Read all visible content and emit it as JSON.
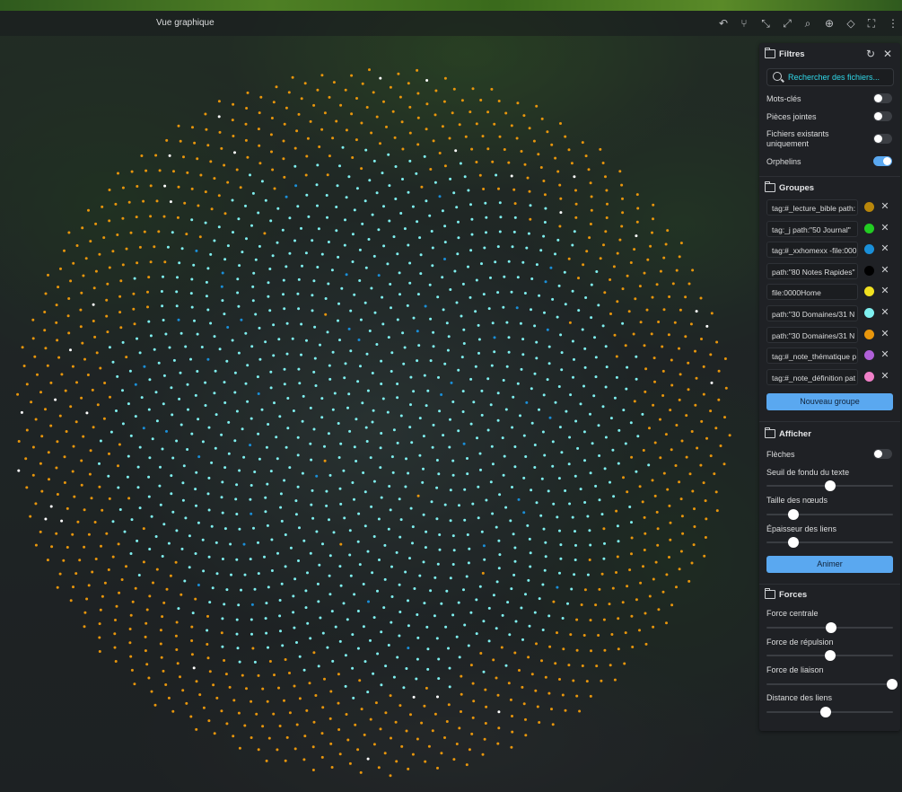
{
  "window": {
    "title": "Vue graphique"
  },
  "toolbar": {
    "icons": [
      "undo-icon",
      "branch-icon",
      "collapse-icon",
      "expand-icon",
      "search-icon",
      "compass-icon",
      "split-icon",
      "fullscreen-icon",
      "more-icon"
    ]
  },
  "filters": {
    "title": "Filtres",
    "search_placeholder": "Rechercher des fichiers...",
    "options": [
      {
        "label": "Mots-clés",
        "on": false
      },
      {
        "label": "Pièces jointes",
        "on": false
      },
      {
        "label": "Fichiers existants uniquement",
        "on": false
      },
      {
        "label": "Orphelins",
        "on": true
      }
    ]
  },
  "groups": {
    "title": "Groupes",
    "items": [
      {
        "query": "tag:#_lecture_bible path:",
        "color": "#b8860b"
      },
      {
        "query": "tag:_j path:\"50 Journal\"",
        "color": "#22cc22"
      },
      {
        "query": "tag:#_xxhomexx  -file:000",
        "color": "#1a8fd8"
      },
      {
        "query": "path:\"80 Notes Rapides\"",
        "color": "#000000"
      },
      {
        "query": "file:0000Home",
        "color": "#f0e020"
      },
      {
        "query": "path:\"30 Domaines/31 N",
        "color": "#7ff0f0"
      },
      {
        "query": "path:\"30 Domaines/31 N",
        "color": "#e8960c"
      },
      {
        "query": "tag:#_note_thématique p",
        "color": "#b060d8"
      },
      {
        "query": "tag:#_note_définition pat",
        "color": "#f080c8"
      }
    ],
    "new_group_label": "Nouveau groupe"
  },
  "display": {
    "title": "Afficher",
    "arrows_label": "Flèches",
    "arrows_on": false,
    "sliders": [
      {
        "label": "Seuil de fondu du texte",
        "value": 0.5
      },
      {
        "label": "Taille des nœuds",
        "value": 0.21
      },
      {
        "label": "Épaisseur des liens",
        "value": 0.21
      }
    ],
    "animate_label": "Animer"
  },
  "forces": {
    "title": "Forces",
    "sliders": [
      {
        "label": "Force centrale",
        "value": 0.51
      },
      {
        "label": "Force de répulsion",
        "value": 0.5
      },
      {
        "label": "Force de liaison",
        "value": 0.99
      },
      {
        "label": "Distance des liens",
        "value": 0.47
      }
    ]
  },
  "graph": {
    "node_colors": {
      "outer": "#e8960c",
      "inner": "#7ff0f0",
      "accent": "#1a8fd8",
      "white": "#ffffff"
    }
  }
}
